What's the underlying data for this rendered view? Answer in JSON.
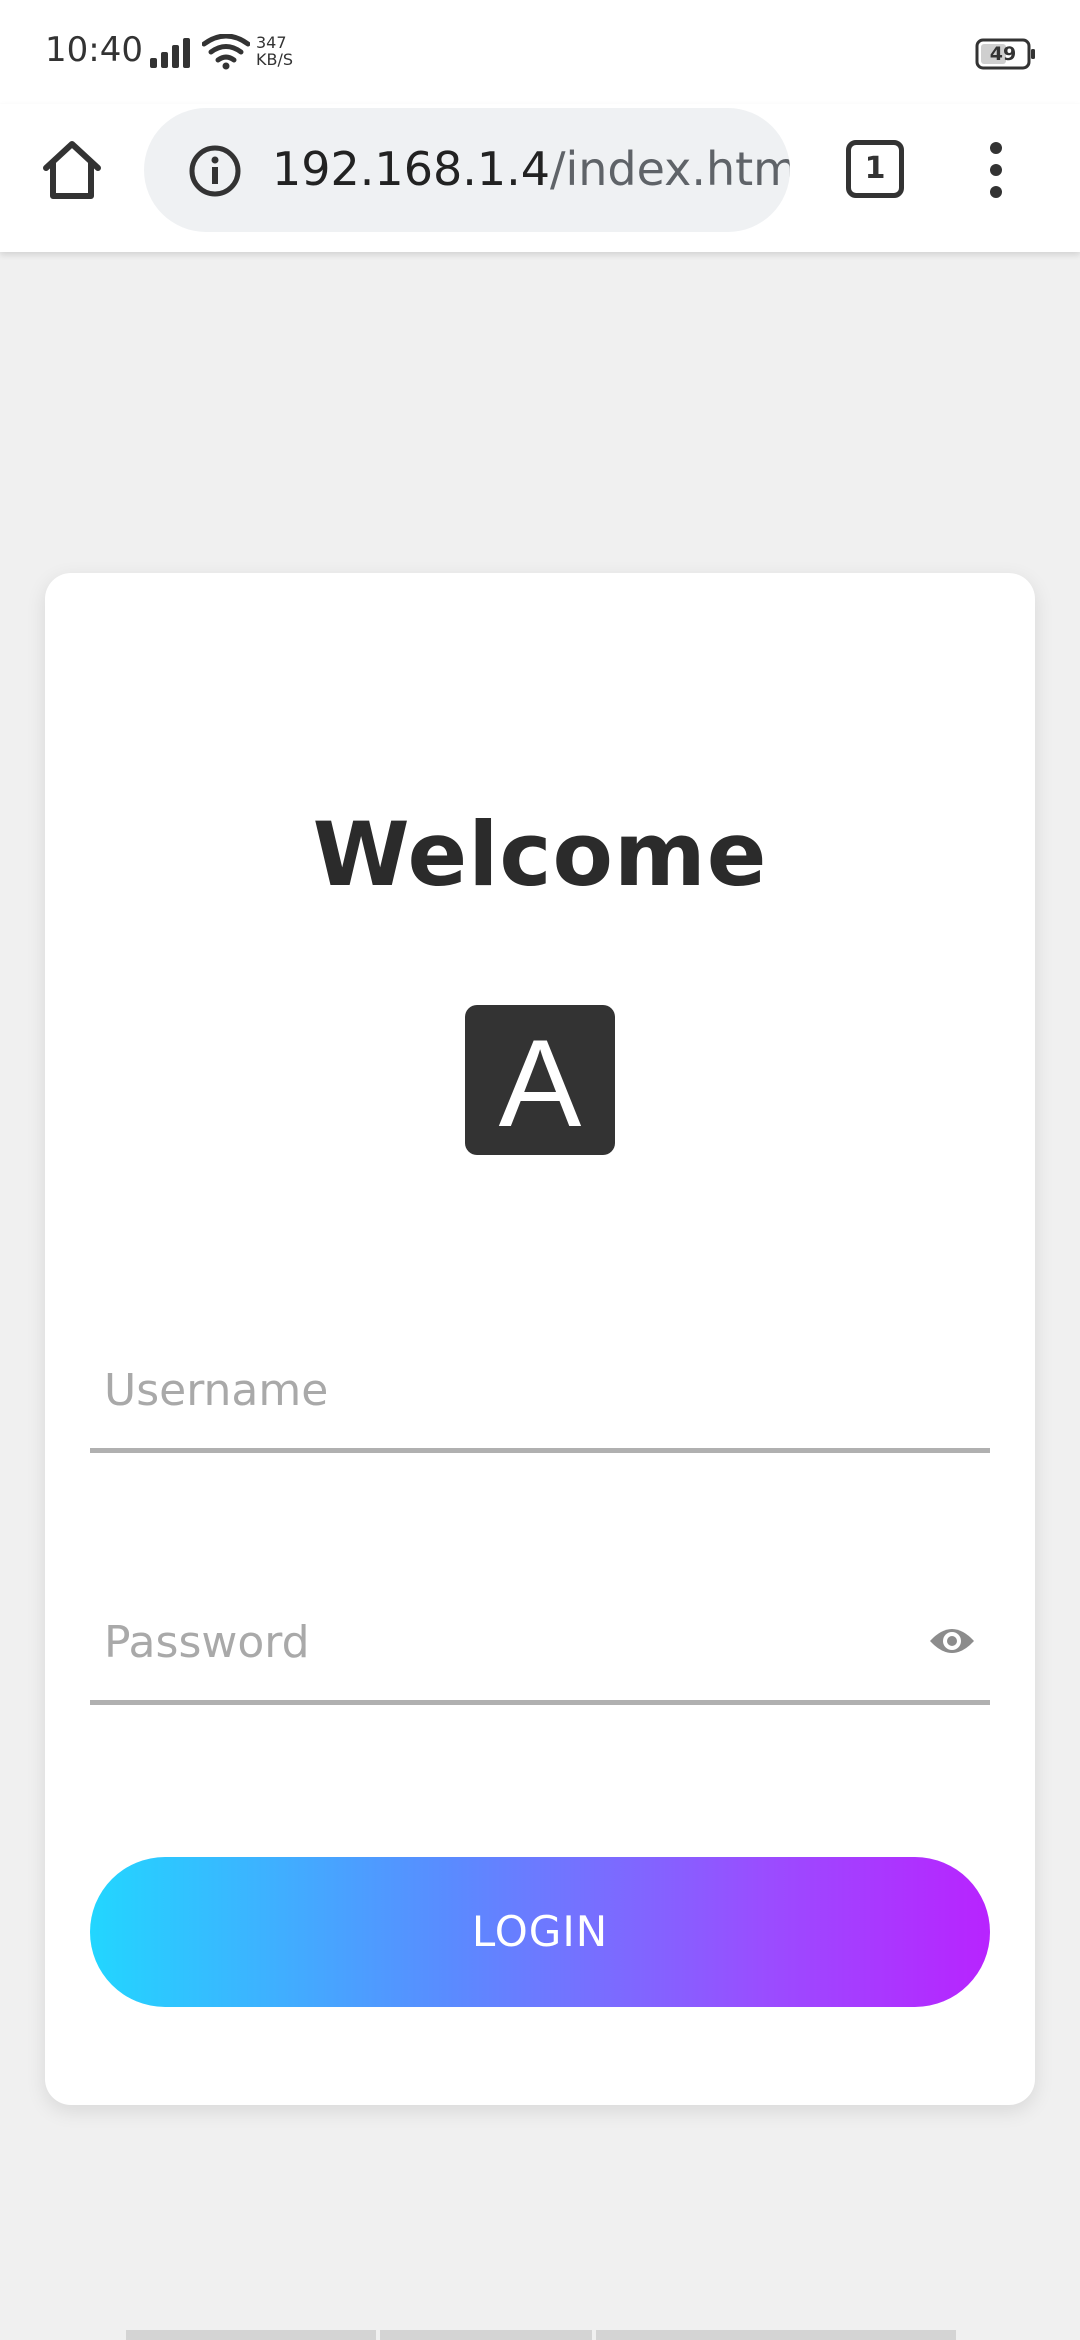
{
  "status_bar": {
    "time": "10:40",
    "net_speed_value": "347",
    "net_speed_unit": "KB/S",
    "battery_level": "49",
    "icons": [
      "signal-icon",
      "wifi-icon",
      "battery-icon"
    ]
  },
  "browser": {
    "url_host": "192.168.1.4",
    "url_path": "/index.html",
    "tab_count": "1",
    "icons": [
      "home-icon",
      "info-icon",
      "tabs-icon",
      "menu-dots-icon"
    ]
  },
  "login": {
    "title": "Welcome",
    "logo_letter": "A",
    "username_placeholder": "Username",
    "username_value": "",
    "password_placeholder": "Password",
    "password_value": "",
    "login_label": "LOGIN",
    "colors": {
      "button_gradient_start": "#22d6ff",
      "button_gradient_end": "#b823ff",
      "logo_background": "#333333",
      "page_background": "#f0f0f0"
    }
  }
}
